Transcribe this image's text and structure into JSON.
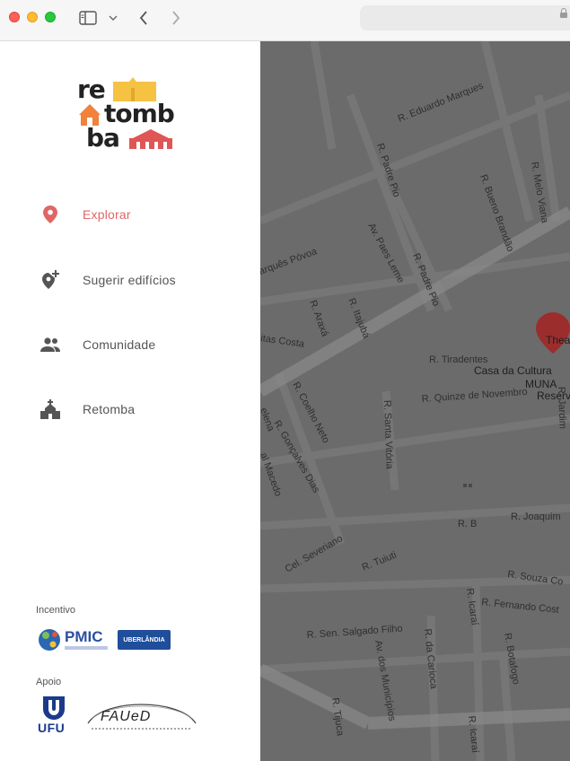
{
  "browser": {
    "sidebar_toggle_icon": "sidebar-icon",
    "back_icon": "chevron-left-icon",
    "forward_icon": "chevron-right-icon",
    "lock_icon": "lock-icon"
  },
  "sidebar": {
    "logo": {
      "line1": "re",
      "line2": "tomb",
      "line3": "ba"
    },
    "nav": [
      {
        "label": "Explorar",
        "icon": "location-pin-icon",
        "active": true
      },
      {
        "label": "Sugerir edifícios",
        "icon": "add-location-icon",
        "active": false
      },
      {
        "label": "Comunidade",
        "icon": "people-icon",
        "active": false
      },
      {
        "label": "Retomba",
        "icon": "church-icon",
        "active": false
      }
    ],
    "incentivo_label": "Incentivo",
    "apoio_label": "Apoio",
    "sponsors": {
      "pmic": "PMIC",
      "uberlandia": "UBERLÂNDIA",
      "ufu": "UFU",
      "faued": "FAUeD"
    }
  },
  "map": {
    "streets": [
      "R. Eduardo Marques",
      "R. Padre Pio",
      "R. Bueno Brandão",
      "R. Melo Viana",
      "Av. Paes Leme",
      "R. Padre Pio",
      "arquês Póvoa",
      "R. Araxá",
      "R. Itajubá",
      "itas Costa",
      "R. Tiradentes",
      "R. Quinze de Novembro",
      "R. Coelho Neto",
      "R. Gonçalves Dias",
      "R. Santa Vitória",
      "elena",
      "al Macedo",
      "R. B",
      "R. Joaquim",
      "Cel. Severiano",
      "R. Tuiuti",
      "R. Souza Co",
      "R. Fernando Cost",
      "R. Icaraí",
      "R. Sen. Salgado Filho",
      "R. da Carioca",
      "R. Botafogo",
      "Av. dos Municípios",
      "R. Tijuca",
      "R. Icaraí",
      "R. Jardim"
    ],
    "pois": [
      "Casa da Cultura",
      "MUNA",
      "Reserv",
      "Thea"
    ]
  }
}
